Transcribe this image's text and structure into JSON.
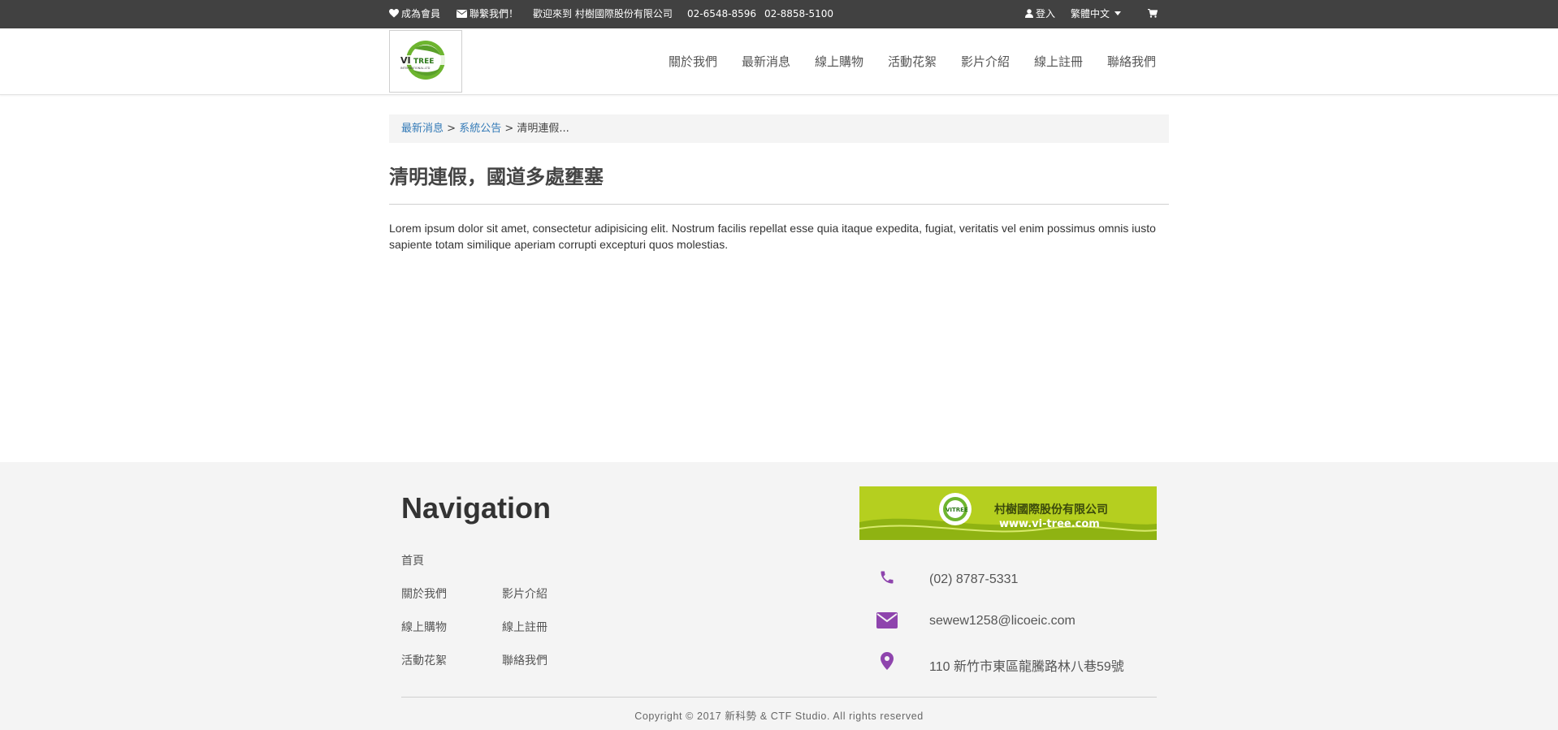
{
  "topbar": {
    "member": "成為會員",
    "contact": "聯繫我們！",
    "welcome": "歡迎來到 村樹國際股份有限公司",
    "phone1": "02-6548-8596",
    "phone2": "02-8858-5100",
    "login": "登入",
    "language": "繁體中文"
  },
  "logo": {
    "text_top": "VITREE",
    "text_bottom": "INTERNATIONAL.LTD"
  },
  "nav": [
    "關於我們",
    "最新消息",
    "線上購物",
    "活動花絮",
    "影片介紹",
    "線上註冊",
    "聯絡我們"
  ],
  "breadcrumb": {
    "item1": "最新消息",
    "sep1": ">",
    "item2": "系統公告",
    "sep2": ">",
    "current": "清明連假..."
  },
  "article": {
    "title": "清明連假，國道多處壅塞",
    "body": "Lorem ipsum dolor sit amet, consectetur adipisicing elit. Nostrum facilis repellat esse quia itaque expedita, fugiat, veritatis vel enim possimus omnis iusto sapiente totam similique aperiam corrupti excepturi quos molestias."
  },
  "footer": {
    "heading": "Navigation",
    "nav": {
      "home": "首頁",
      "about": "關於我們",
      "video": "影片介紹",
      "shop": "線上購物",
      "register": "線上註冊",
      "events": "活動花絮",
      "contact": "聯絡我們"
    },
    "banner": {
      "company": "村樹國際股份有限公司",
      "url": "www.vi-tree.com"
    },
    "contact": {
      "phone": "(02) 8787-5331",
      "email": "sewew1258@licoeic.com",
      "address": "110 新竹市東區龍騰路林八巷59號"
    },
    "copyright": "Copyright © 2017 新科勢 & CTF Studio. All rights reserved"
  },
  "colors": {
    "topbar_bg": "#414141",
    "link": "#337ab7",
    "footer_icon": "#8e44ad",
    "banner_green": "#b5cf1f"
  },
  "icons": {
    "member": "heart-icon",
    "contact": "envelope-icon",
    "login": "user-icon",
    "cart": "shopping-cart-icon",
    "phone": "phone-icon",
    "email": "envelope-icon",
    "address": "map-marker-icon"
  }
}
